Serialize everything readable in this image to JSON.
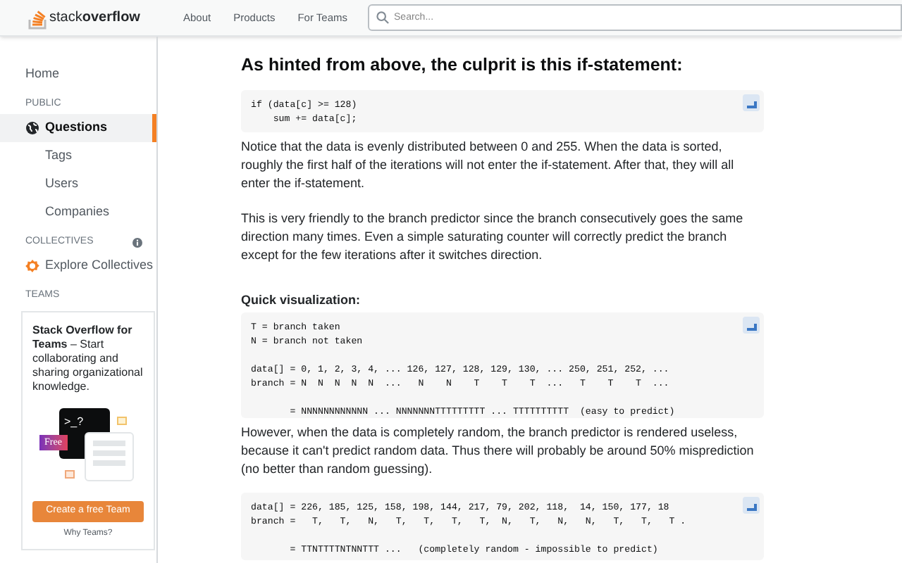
{
  "header": {
    "logo": {
      "light": "stack",
      "bold": "overflow"
    },
    "nav": [
      "About",
      "Products",
      "For Teams"
    ],
    "search": {
      "placeholder": "Search..."
    }
  },
  "sidebar": {
    "home": "Home",
    "sections": [
      {
        "heading": "PUBLIC",
        "info": false,
        "items": [
          {
            "label": "Questions",
            "kind": "globe",
            "selected": true
          },
          {
            "label": "Tags",
            "kind": "plain",
            "selected": false
          },
          {
            "label": "Users",
            "kind": "plain",
            "selected": false
          },
          {
            "label": "Companies",
            "kind": "plain",
            "selected": false
          }
        ]
      },
      {
        "heading": "COLLECTIVES",
        "info": true,
        "items": [
          {
            "label": "Explore Collectives",
            "kind": "collective",
            "selected": false
          }
        ]
      },
      {
        "heading": "TEAMS",
        "info": false
      }
    ],
    "teams_card": {
      "title": "Stack Overflow for Teams",
      "text": " – Start collaborating and sharing organizational knowledge.",
      "badge": "Free",
      "prompt": ">_?",
      "button": "Create a free Team",
      "link": "Why Teams?"
    }
  },
  "content": [
    {
      "kind": "heading",
      "text": "As hinted from above, the culprit is this if-statement:"
    },
    {
      "kind": "code",
      "groups": [
        [
          "if (data[c] >= 128)",
          "    sum += data[c];"
        ]
      ]
    },
    {
      "kind": "paragraph",
      "text": "Notice that the data is evenly distributed between 0 and 255. When the data is sorted, roughly the first half of the iterations will not enter the if-statement. After that, they will all enter the if-statement."
    },
    {
      "kind": "paragraph",
      "text": "This is very friendly to the branch predictor since the branch consecutively goes the same direction many times. Even a simple saturating counter will correctly predict the branch except for the few iterations after it switches direction."
    },
    {
      "kind": "subheading",
      "text": "Quick visualization:"
    },
    {
      "kind": "code",
      "groups": [
        [
          "T = branch taken",
          "N = branch not taken"
        ],
        [
          "data[] = 0, 1, 2, 3, 4, ... 126, 127, 128, 129, 130, ... 250, 251, 252, ...",
          "branch = N  N  N  N  N  ...   N    N    T    T    T  ...   T    T    T  ..."
        ],
        [
          "       = NNNNNNNNNNNN ... NNNNNNNTTTTTTTTT ... TTTTTTTTTT  (easy to predict)"
        ]
      ]
    },
    {
      "kind": "paragraph",
      "text": "However, when the data is completely random, the branch predictor is rendered useless, because it can't predict random data. Thus there will probably be around 50% misprediction (no better than random guessing)."
    },
    {
      "kind": "code",
      "groups": [
        [
          "data[] = 226, 185, 125, 158, 198, 144, 217, 79, 202, 118,  14, 150, 177, 18",
          "branch =   T,   T,   N,   T,   T,   T,   T,  N,   T,   N,   N,   T,   T,   T ."
        ],
        [
          "       = TTNTTTTNTNNTTT ...   (completely random - impossible to predict)"
        ]
      ]
    }
  ]
}
